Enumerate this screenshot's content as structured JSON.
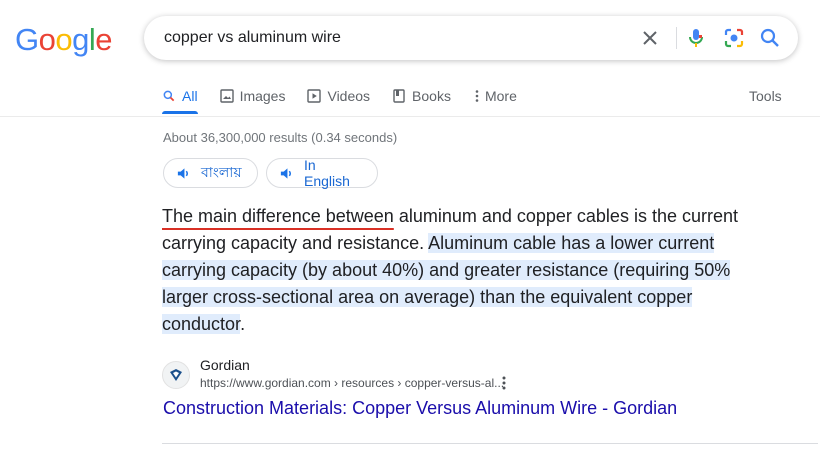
{
  "logo": {
    "letters": [
      "G",
      "o",
      "o",
      "g",
      "l",
      "e"
    ],
    "colors": [
      "#4285F4",
      "#EA4335",
      "#FBBC05",
      "#4285F4",
      "#34A853",
      "#EA4335"
    ]
  },
  "search": {
    "query": "copper vs aluminum wire",
    "icons": [
      "clear-icon",
      "microphone-icon",
      "camera-lens-icon",
      "search-icon"
    ]
  },
  "tabs": [
    {
      "label": "All",
      "icon": "search-icon",
      "active": true
    },
    {
      "label": "Images",
      "icon": "image-icon"
    },
    {
      "label": "Videos",
      "icon": "play-icon"
    },
    {
      "label": "Books",
      "icon": "book-icon"
    },
    {
      "label": "More",
      "icon": "dots-vertical-icon"
    }
  ],
  "tools_label": "Tools",
  "stats": "About 36,300,000 results (0.34 seconds)",
  "lang_buttons": [
    {
      "label": "বাংলায়",
      "icon": "speaker-icon"
    },
    {
      "label": "In English",
      "icon": "speaker-icon"
    }
  ],
  "snippet": {
    "part1": "The main difference between",
    "part2": " aluminum and copper cables is the current carrying capacity and resistance. ",
    "highlighted": "Aluminum cable has a lower current carrying capacity (by about 40%) and greater resistance (requiring 50% larger cross-sectional area on average) than the equivalent copper conductor",
    "end": "."
  },
  "result": {
    "site_name": "Gordian",
    "url": "https://www.gordian.com › resources › copper-versus-al...",
    "title": "Construction Materials: Copper Versus Aluminum Wire - Gordian"
  },
  "colors": {
    "link": "#1a0dab",
    "accent": "#1a73e8",
    "highlight": "#e0ecfc",
    "underline_red": "#d93025"
  }
}
